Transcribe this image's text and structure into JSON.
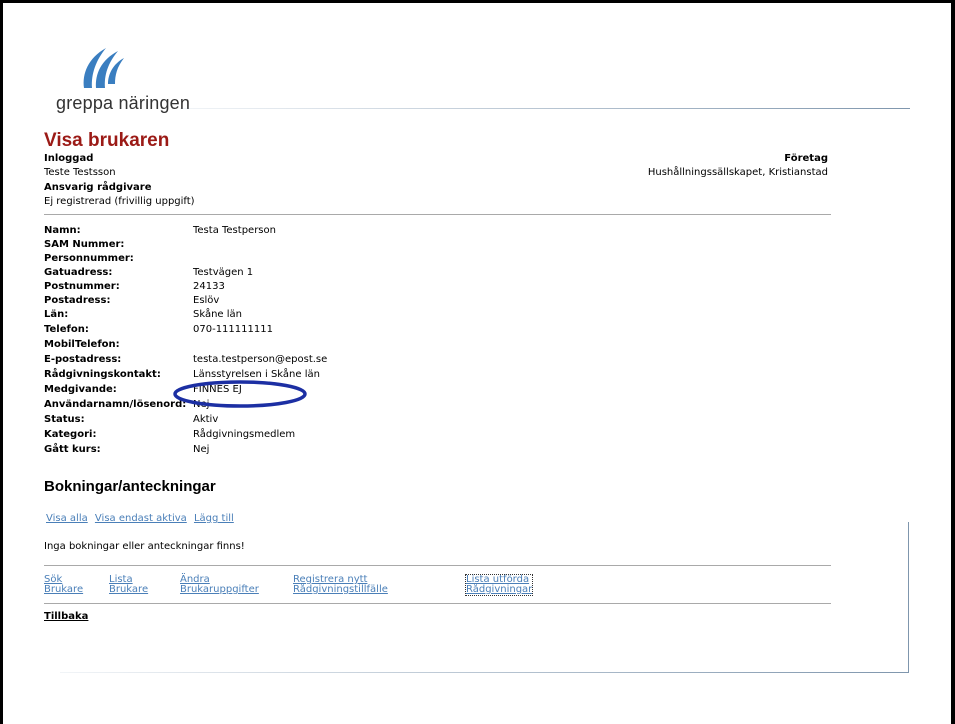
{
  "brand": {
    "name": "greppa näringen",
    "accent": "#3a7ec0",
    "title_color": "#9b1a16",
    "link_color": "#4a7fb8"
  },
  "page": {
    "title": "Visa brukaren"
  },
  "header": {
    "inloggad_label": "Inloggad",
    "inloggad_value": "Teste Testsson",
    "ansvarig_label": "Ansvarig rådgivare",
    "ansvarig_value": "Ej registrerad (frivillig uppgift)",
    "foretag_label": "Företag",
    "foretag_value": "Hushållningssällskapet, Kristianstad"
  },
  "details": [
    {
      "label": "Namn:",
      "value": "Testa Testperson"
    },
    {
      "label": "SAM Nummer:",
      "value": ""
    },
    {
      "label": "Personnummer:",
      "value": ""
    },
    {
      "label": "Gatuadress:",
      "value": "Testvägen 1"
    },
    {
      "label": "Postnummer:",
      "value": "24133"
    },
    {
      "label": "Postadress:",
      "value": "Eslöv"
    },
    {
      "label": "Län:",
      "value": "Skåne län"
    },
    {
      "label": "Telefon:",
      "value": "070-111111111"
    },
    {
      "label": "MobilTelefon:",
      "value": ""
    },
    {
      "label": "E-postadress:",
      "value": "testa.testperson@epost.se"
    },
    {
      "label": "Rådgivningskontakt:",
      "value": "Länsstyrelsen i Skåne län"
    },
    {
      "label": "Medgivande:",
      "value": "FINNES EJ"
    },
    {
      "label": "Användarnamn/lösenord:",
      "value": "Nej"
    },
    {
      "label": "Status:",
      "value": "Aktiv"
    },
    {
      "label": "Kategori:",
      "value": "Rådgivningsmedlem"
    },
    {
      "label": "Gått kurs:",
      "value": "Nej"
    }
  ],
  "bookings": {
    "title": "Bokningar/anteckningar",
    "links": {
      "show_all": "Visa alla",
      "show_active": "Visa endast aktiva",
      "add": "Lägg till"
    },
    "empty_text": "Inga bokningar eller anteckningar finns!"
  },
  "nav": [
    {
      "line1": "Sök",
      "line2": "Brukare"
    },
    {
      "line1": "Lista",
      "line2": "Brukare"
    },
    {
      "line1": "Ändra",
      "line2": "Brukaruppgifter"
    },
    {
      "line1": "Registrera nytt",
      "line2": "Rådgivningstillfälle"
    },
    {
      "line1": "Lista utförda",
      "line2": "Rådgivningar"
    }
  ],
  "back_label": "Tillbaka"
}
